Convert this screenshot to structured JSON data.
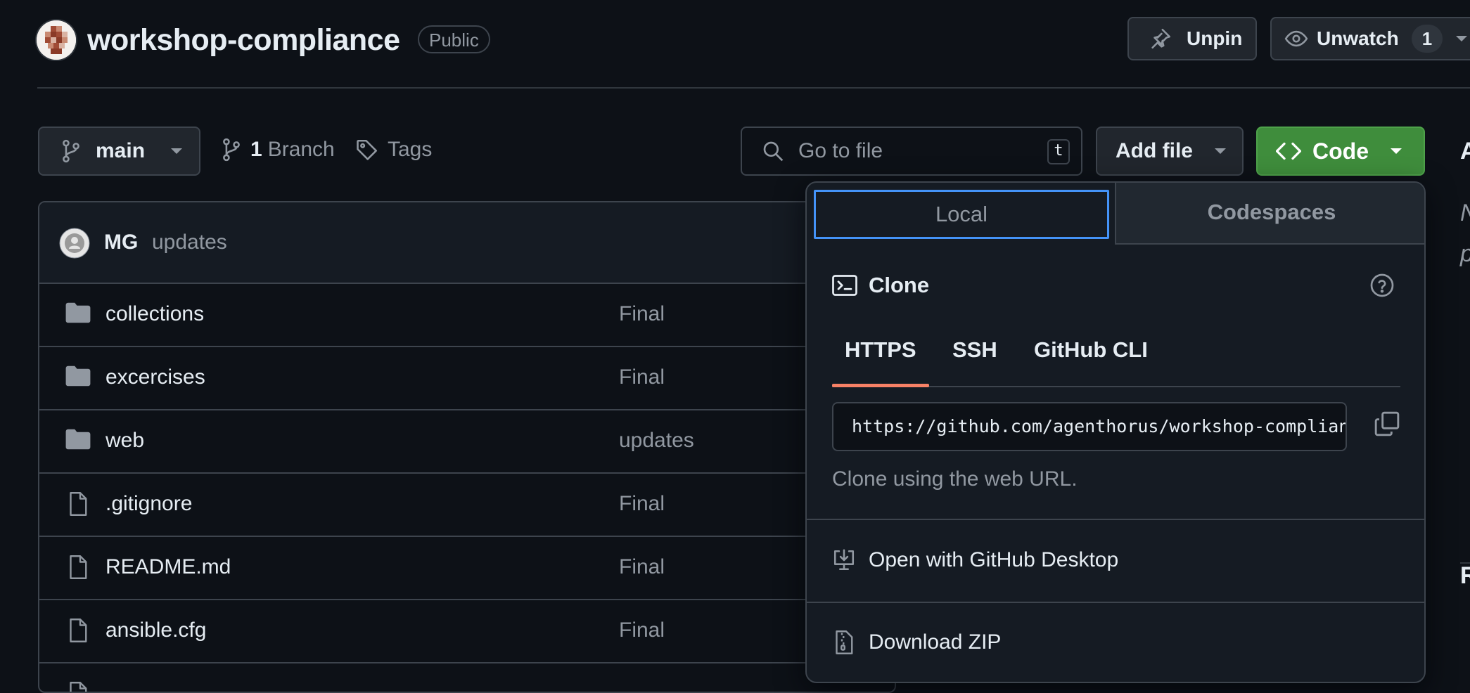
{
  "header": {
    "repo_name": "workshop-compliance",
    "visibility": "Public",
    "unpin_label": "Unpin",
    "unwatch_label": "Unwatch",
    "watch_count": "1"
  },
  "toolbar": {
    "branch": "main",
    "branch_count": "1",
    "branch_label": "Branch",
    "tags_label": "Tags",
    "search_placeholder": "Go to file",
    "search_shortcut": "t",
    "add_file_label": "Add file",
    "code_label": "Code"
  },
  "latest_commit": {
    "author": "MG",
    "message": "updates"
  },
  "files": [
    {
      "name": "collections",
      "type": "folder",
      "message": "Final"
    },
    {
      "name": "excercises",
      "type": "folder",
      "message": "Final"
    },
    {
      "name": "web",
      "type": "folder",
      "message": "updates"
    },
    {
      "name": ".gitignore",
      "type": "file",
      "message": "Final"
    },
    {
      "name": "README.md",
      "type": "file",
      "message": "Final"
    },
    {
      "name": "ansible.cfg",
      "type": "file",
      "message": "Final"
    }
  ],
  "code_dropdown": {
    "tabs": [
      "Local",
      "Codespaces"
    ],
    "active_tab": "Local",
    "clone_title": "Clone",
    "protocols": [
      "HTTPS",
      "SSH",
      "GitHub CLI"
    ],
    "active_protocol": "HTTPS",
    "clone_url": "https://github.com/agenthorus/workshop-compliance.git",
    "clone_hint": "Clone using the web URL.",
    "open_desktop_label": "Open with GitHub Desktop",
    "download_zip_label": "Download ZIP"
  },
  "colors": {
    "background": "#0d1117",
    "code_button": "#3f8d3c",
    "active_tab_border": "#4493f8",
    "protocol_underline": "#f78166"
  }
}
